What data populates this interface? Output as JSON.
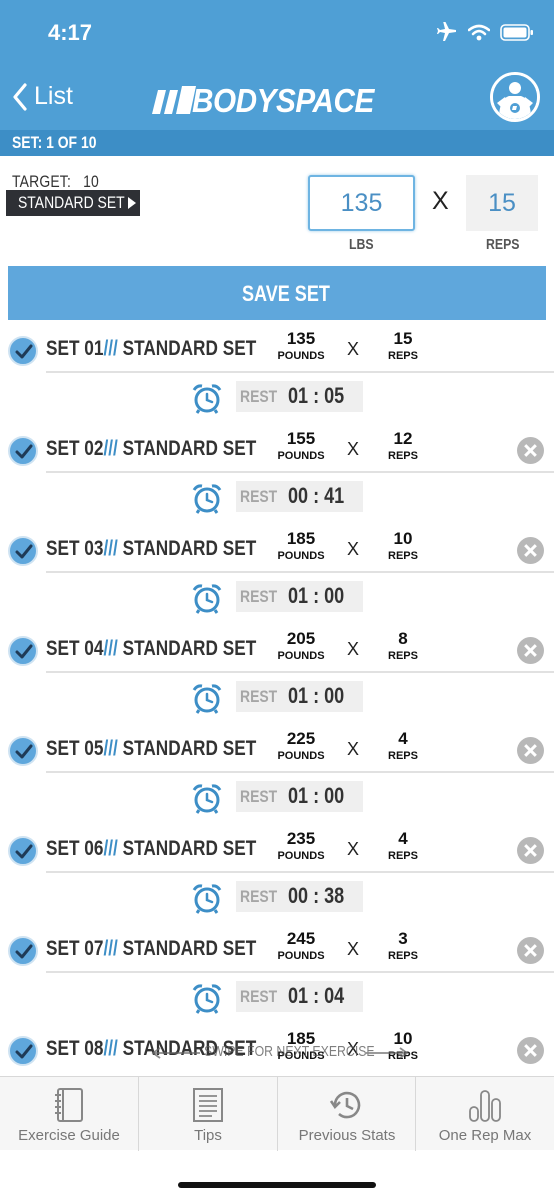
{
  "status": {
    "time": "4:17"
  },
  "header": {
    "back_label": "List",
    "logo_text": "BODYSPACE"
  },
  "set_progress": "SET: 1 OF 10",
  "target": {
    "label": "TARGET:",
    "value": "10",
    "set_type": "STANDARD SET"
  },
  "entry": {
    "weight": "135",
    "weight_unit": "LBS",
    "multiplier": "X",
    "reps": "15",
    "reps_unit": "REPS"
  },
  "save_label": "SAVE SET",
  "sets": [
    {
      "title": "SET 01",
      "type": "STANDARD SET",
      "weight": "135",
      "reps": "15",
      "rest": "01 : 05"
    },
    {
      "title": "SET 02",
      "type": "STANDARD SET",
      "weight": "155",
      "reps": "12",
      "rest": "00 : 41"
    },
    {
      "title": "SET 03",
      "type": "STANDARD SET",
      "weight": "185",
      "reps": "10",
      "rest": "01 : 00"
    },
    {
      "title": "SET 04",
      "type": "STANDARD SET",
      "weight": "205",
      "reps": "8",
      "rest": "01 : 00"
    },
    {
      "title": "SET 05",
      "type": "STANDARD SET",
      "weight": "225",
      "reps": "4",
      "rest": "01 : 00"
    },
    {
      "title": "SET 06",
      "type": "STANDARD SET",
      "weight": "235",
      "reps": "4",
      "rest": "00 : 38"
    },
    {
      "title": "SET 07",
      "type": "STANDARD SET",
      "weight": "245",
      "reps": "3",
      "rest": "01 : 04"
    },
    {
      "title": "SET 08",
      "type": "STANDARD SET",
      "weight": "185",
      "reps": "10"
    }
  ],
  "set_labels": {
    "pounds": "POUNDS",
    "reps": "REPS",
    "x": "X",
    "slash": "///",
    "rest": "REST"
  },
  "swipe_hint": "SWIPE FOR NEXT EXERCISE",
  "tabs": [
    {
      "label": "Exercise Guide",
      "icon": "notebook-icon"
    },
    {
      "label": "Tips",
      "icon": "document-icon"
    },
    {
      "label": "Previous Stats",
      "icon": "history-icon"
    },
    {
      "label": "One Rep Max",
      "icon": "bar-chart-icon"
    }
  ],
  "colors": {
    "brand_blue": "#4f9fd5",
    "dark_blue": "#3d8ec6",
    "button_blue": "#5fa7dc"
  }
}
